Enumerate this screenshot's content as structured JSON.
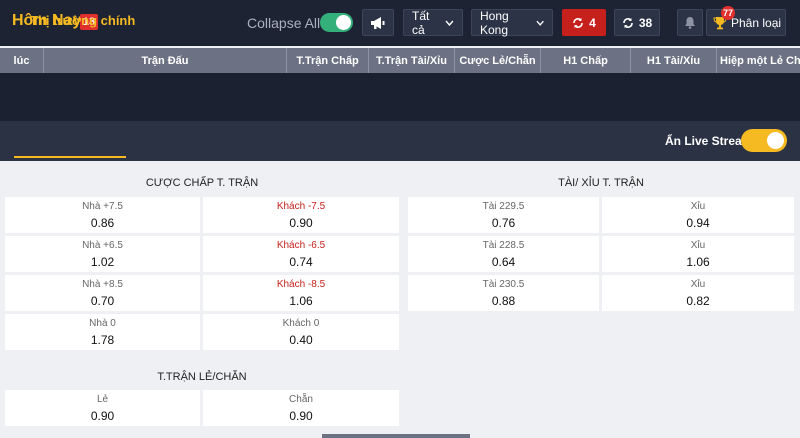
{
  "header": {
    "title": "Hôm Nay",
    "count": "13",
    "collapse_label": "Collapse All",
    "filter_all": "Tất cả",
    "region": "Hong Kong",
    "live_count": "4",
    "refresh_count": "38",
    "notification_count": "77",
    "filter_label": "Phân loại"
  },
  "columns": [
    "lúc",
    "Trận Đấu",
    "T.Trận Chấp",
    "T.Trận Tài/Xỉu",
    "Cược Lẻ/Chẵn",
    "H1 Chấp",
    "H1 Tài/Xỉu",
    "Hiệp một Lẻ Chẵn"
  ],
  "section": {
    "title": "Thị trường chính",
    "live_stream_label": "Ẩn Live Stream"
  },
  "handicap": {
    "title": "CƯỢC CHẤP T. TRẬN",
    "rows": [
      {
        "home_label": "Nhà +7.5",
        "home_value": "0.86",
        "away_label": "Khách -7.5",
        "away_value": "0.90"
      },
      {
        "home_label": "Nhà +6.5",
        "home_value": "1.02",
        "away_label": "Khách -6.5",
        "away_value": "0.74"
      },
      {
        "home_label": "Nhà +8.5",
        "home_value": "0.70",
        "away_label": "Khách -8.5",
        "away_value": "1.06"
      },
      {
        "home_label": "Nhà 0",
        "home_value": "1.78",
        "away_label": "Khách 0",
        "away_value": "0.40"
      }
    ]
  },
  "overunder": {
    "title": "TÀI/ XỈU T. TRẬN",
    "rows": [
      {
        "over_label": "Tài 229.5",
        "over_value": "0.76",
        "under_label": "Xỉu",
        "under_value": "0.94"
      },
      {
        "over_label": "Tài 228.5",
        "over_value": "0.64",
        "under_label": "Xỉu",
        "under_value": "1.06"
      },
      {
        "over_label": "Tài 230.5",
        "over_value": "0.88",
        "under_label": "Xỉu",
        "under_value": "0.82"
      }
    ]
  },
  "oddeven": {
    "title": "T.TRẬN LẺ/CHẴN",
    "odd_label": "Lẻ",
    "odd_value": "0.90",
    "even_label": "Chẵn",
    "even_value": "0.90"
  },
  "colors": {
    "accent": "#f5b921",
    "negative_red": "#c6201c",
    "toggle_green": "#34b07a",
    "topbar": "#1e2334"
  }
}
